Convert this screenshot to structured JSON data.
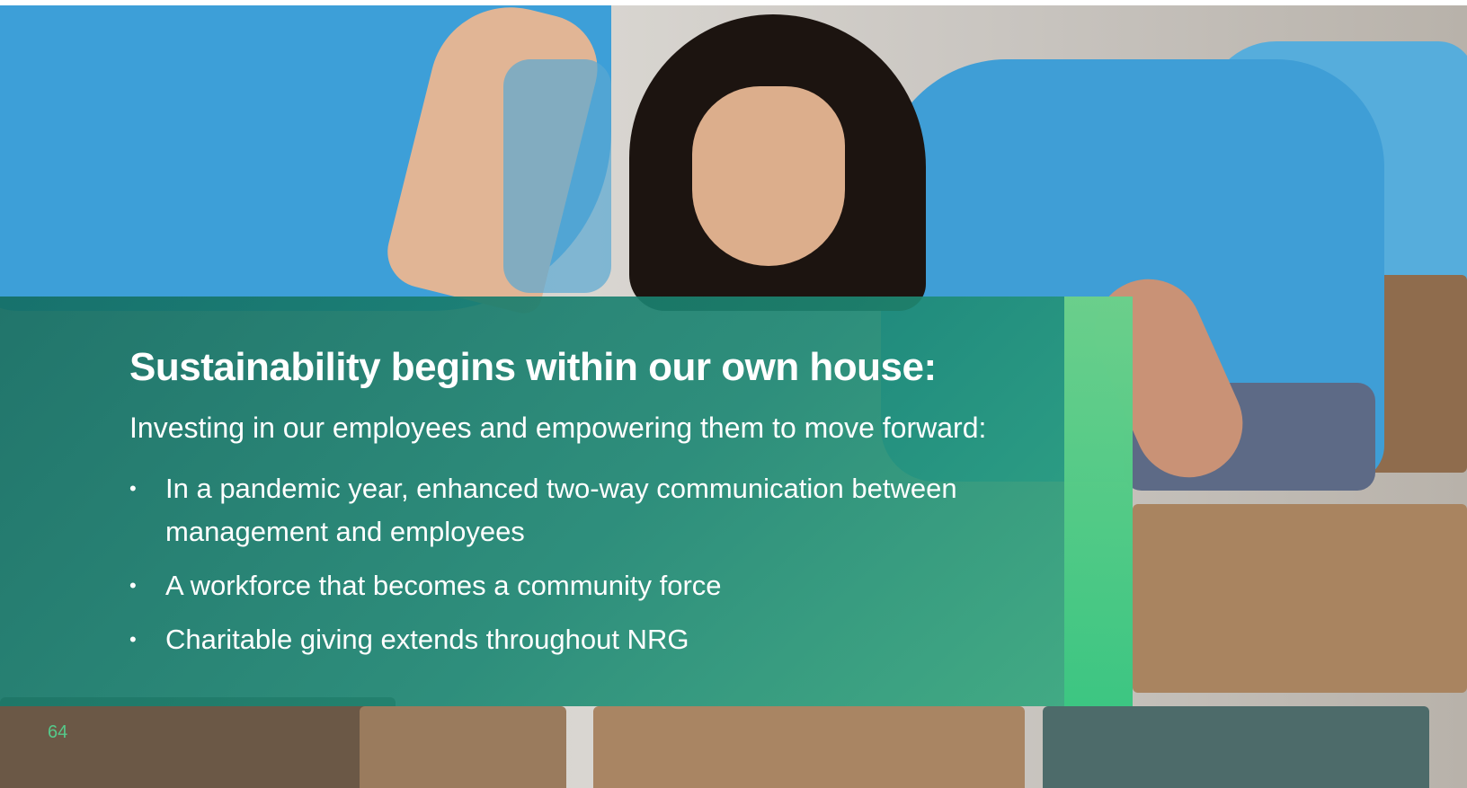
{
  "slide": {
    "title": "Sustainability begins within our own house:",
    "subtitle": "Investing in our employees and empowering them to move forward:",
    "bullets": [
      {
        "marker": "•",
        "text": "In a pandemic year, enhanced two-way communication between management and employees"
      },
      {
        "marker": "•",
        "text": "A workforce that becomes a community force"
      },
      {
        "marker": "•",
        "text": "Charitable giving extends throughout NRG"
      }
    ],
    "page_number": "64"
  },
  "colors": {
    "panel": "#1c8773",
    "accent_strip": "#4fcf8a",
    "page_number": "#55c98a",
    "shirt": "#42a3da"
  }
}
